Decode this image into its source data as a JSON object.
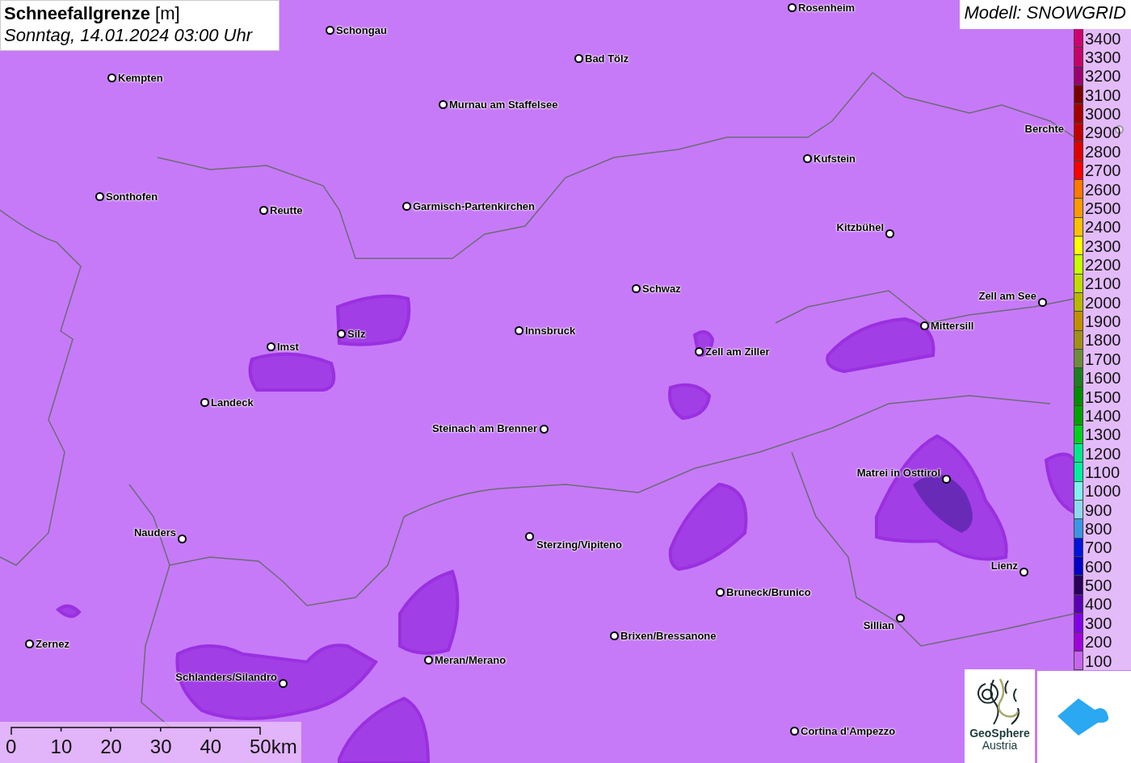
{
  "title": {
    "heading": "Schneefallgrenze",
    "unit": "[m]",
    "datetime": "Sonntag, 14.01.2024 03:00 Uhr"
  },
  "model_label": "Modell: SNOWGRID",
  "cities": [
    "Rosenheim",
    "Schongau",
    "Bad Tölz",
    "Kempten",
    "Murnau am Staffelsee",
    "Berchte",
    "Kufstein",
    "Sonthofen",
    "Reutte",
    "Garmisch-Partenkirchen",
    "Kitzbühel",
    "Schwaz",
    "Zell am See",
    "Mittersill",
    "Silz",
    "Innsbruck",
    "Imst",
    "Zell am Ziller",
    "Landeck",
    "Steinach am Brenner",
    "Matrei in Osttirol",
    "Nauders",
    "Sterzing/Vipiteno",
    "Lienz",
    "Bruneck/Brunico",
    "Sillian",
    "Brixen/Bressanone",
    "Zernez",
    "Meran/Merano",
    "Schlanders/Silandro",
    "Cortina d'Ampezzo"
  ],
  "legend": [
    {
      "label": "3400",
      "color": "#d0006f"
    },
    {
      "label": "3300",
      "color": "#c8006a"
    },
    {
      "label": "3200",
      "color": "#9c0070"
    },
    {
      "label": "3100",
      "color": "#7a0000"
    },
    {
      "label": "3000",
      "color": "#a50000"
    },
    {
      "label": "2900",
      "color": "#c00000"
    },
    {
      "label": "2800",
      "color": "#e00000"
    },
    {
      "label": "2700",
      "color": "#ff0000"
    },
    {
      "label": "2600",
      "color": "#ff7800"
    },
    {
      "label": "2500",
      "color": "#ff9900"
    },
    {
      "label": "2400",
      "color": "#ffc000"
    },
    {
      "label": "2300",
      "color": "#ffff00"
    },
    {
      "label": "2200",
      "color": "#c8ff00"
    },
    {
      "label": "2100",
      "color": "#c0dc00"
    },
    {
      "label": "2000",
      "color": "#b8b800"
    },
    {
      "label": "1900",
      "color": "#c09000"
    },
    {
      "label": "1800",
      "color": "#a09018"
    },
    {
      "label": "1700",
      "color": "#6e8c3c"
    },
    {
      "label": "1600",
      "color": "#1e7d1e"
    },
    {
      "label": "1500",
      "color": "#008c00"
    },
    {
      "label": "1400",
      "color": "#00a000"
    },
    {
      "label": "1300",
      "color": "#00d020"
    },
    {
      "label": "1200",
      "color": "#00e88c"
    },
    {
      "label": "1100",
      "color": "#00f0a0"
    },
    {
      "label": "1000",
      "color": "#80f0f0"
    },
    {
      "label": "900",
      "color": "#90d8f0"
    },
    {
      "label": "800",
      "color": "#3c96e6"
    },
    {
      "label": "700",
      "color": "#0014dc"
    },
    {
      "label": "600",
      "color": "#0000c8"
    },
    {
      "label": "500",
      "color": "#28005a"
    },
    {
      "label": "400",
      "color": "#5a00b4"
    },
    {
      "label": "300",
      "color": "#8200e6"
    },
    {
      "label": "200",
      "color": "#a000dc"
    },
    {
      "label": "100",
      "color": "#c864f0"
    }
  ],
  "scale_bar": [
    "0",
    "10",
    "20",
    "30",
    "40",
    "50km"
  ],
  "logo": {
    "name": "GeoSphere",
    "country": "Austria"
  }
}
